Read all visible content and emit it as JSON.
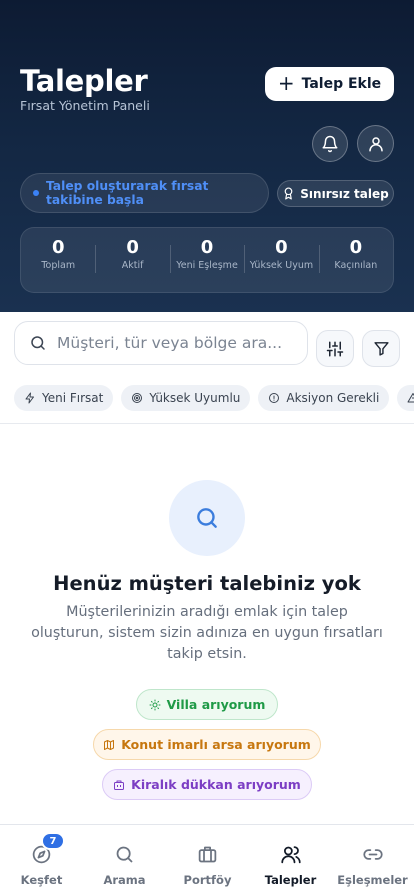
{
  "header": {
    "title": "Talepler",
    "subtitle": "Fırsat Yönetim Paneli",
    "add_button": "Talep Ekle",
    "hint": "Talep oluşturarak fırsat takibine başla",
    "unlimited": "Sınırsız talep"
  },
  "stats": [
    {
      "value": "0",
      "label": "Toplam"
    },
    {
      "value": "0",
      "label": "Aktif"
    },
    {
      "value": "0",
      "label": "Yeni Eşleşme"
    },
    {
      "value": "0",
      "label": "Yüksek Uyum"
    },
    {
      "value": "0",
      "label": "Kaçınılan"
    }
  ],
  "search": {
    "placeholder": "Müşteri, tür veya bölge ara..."
  },
  "chips": [
    {
      "label": "Yeni Fırsat",
      "icon": "lightning-icon"
    },
    {
      "label": "Yüksek Uyumlu",
      "icon": "target-icon"
    },
    {
      "label": "Aksiyon Gerekli",
      "icon": "alert-circle-icon"
    },
    {
      "label": "",
      "icon": "warning-icon"
    }
  ],
  "empty": {
    "title": "Henüz müşteri talebiniz yok",
    "description": "Müşterilerinizin aradığı emlak için talep oluşturun, sistem sizin adınıza en uygun fırsatları takip etsin.",
    "suggestions": [
      {
        "label": "Villa arıyorum",
        "icon": "sun-icon",
        "color": "#1f9a47"
      },
      {
        "label": "Konut imarlı arsa arıyorum",
        "icon": "map-icon",
        "color": "#c7770f"
      },
      {
        "label": "Kiralık dükkan arıyorum",
        "icon": "store-icon",
        "color": "#7c3ec4"
      }
    ]
  },
  "nav": {
    "items": [
      {
        "label": "Keşfet",
        "icon": "compass-icon",
        "badge": "7"
      },
      {
        "label": "Arama",
        "icon": "search-icon"
      },
      {
        "label": "Portföy",
        "icon": "briefcase-icon"
      },
      {
        "label": "Talepler",
        "icon": "users-icon",
        "active": true
      },
      {
        "label": "Eşleşmeler",
        "icon": "link-icon"
      }
    ]
  },
  "colors": {
    "header_bg": "#0d1b33",
    "accent": "#2f6fe4"
  }
}
